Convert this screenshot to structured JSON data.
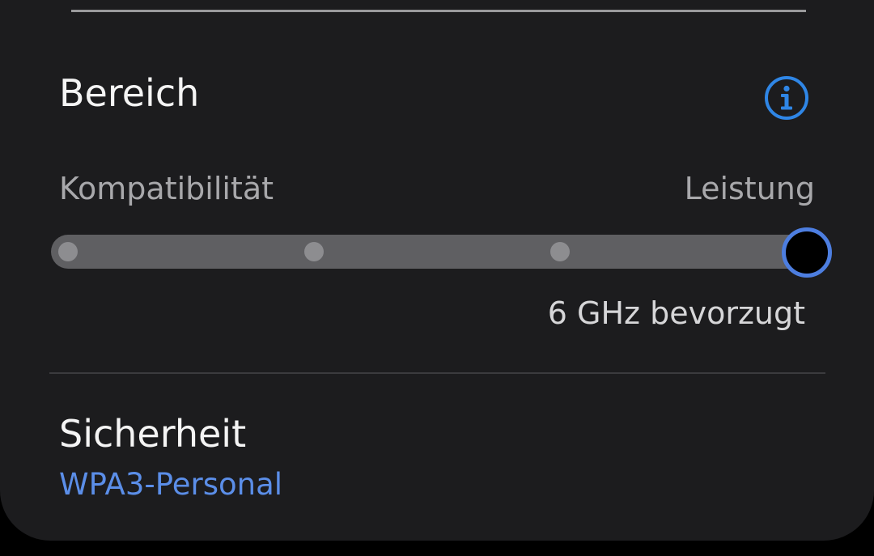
{
  "band": {
    "title": "Bereich",
    "info_icon": "info-icon",
    "slider": {
      "label_left": "Kompatibilität",
      "label_right": "Leistung",
      "steps": 4,
      "selected_step": 4,
      "value_text": "6 GHz bevorzugt"
    }
  },
  "security": {
    "title": "Sicherheit",
    "value": "WPA3-Personal"
  },
  "colors": {
    "accent": "#4d7ee0",
    "link": "#5b8ee8",
    "background": "#1c1c1e"
  }
}
